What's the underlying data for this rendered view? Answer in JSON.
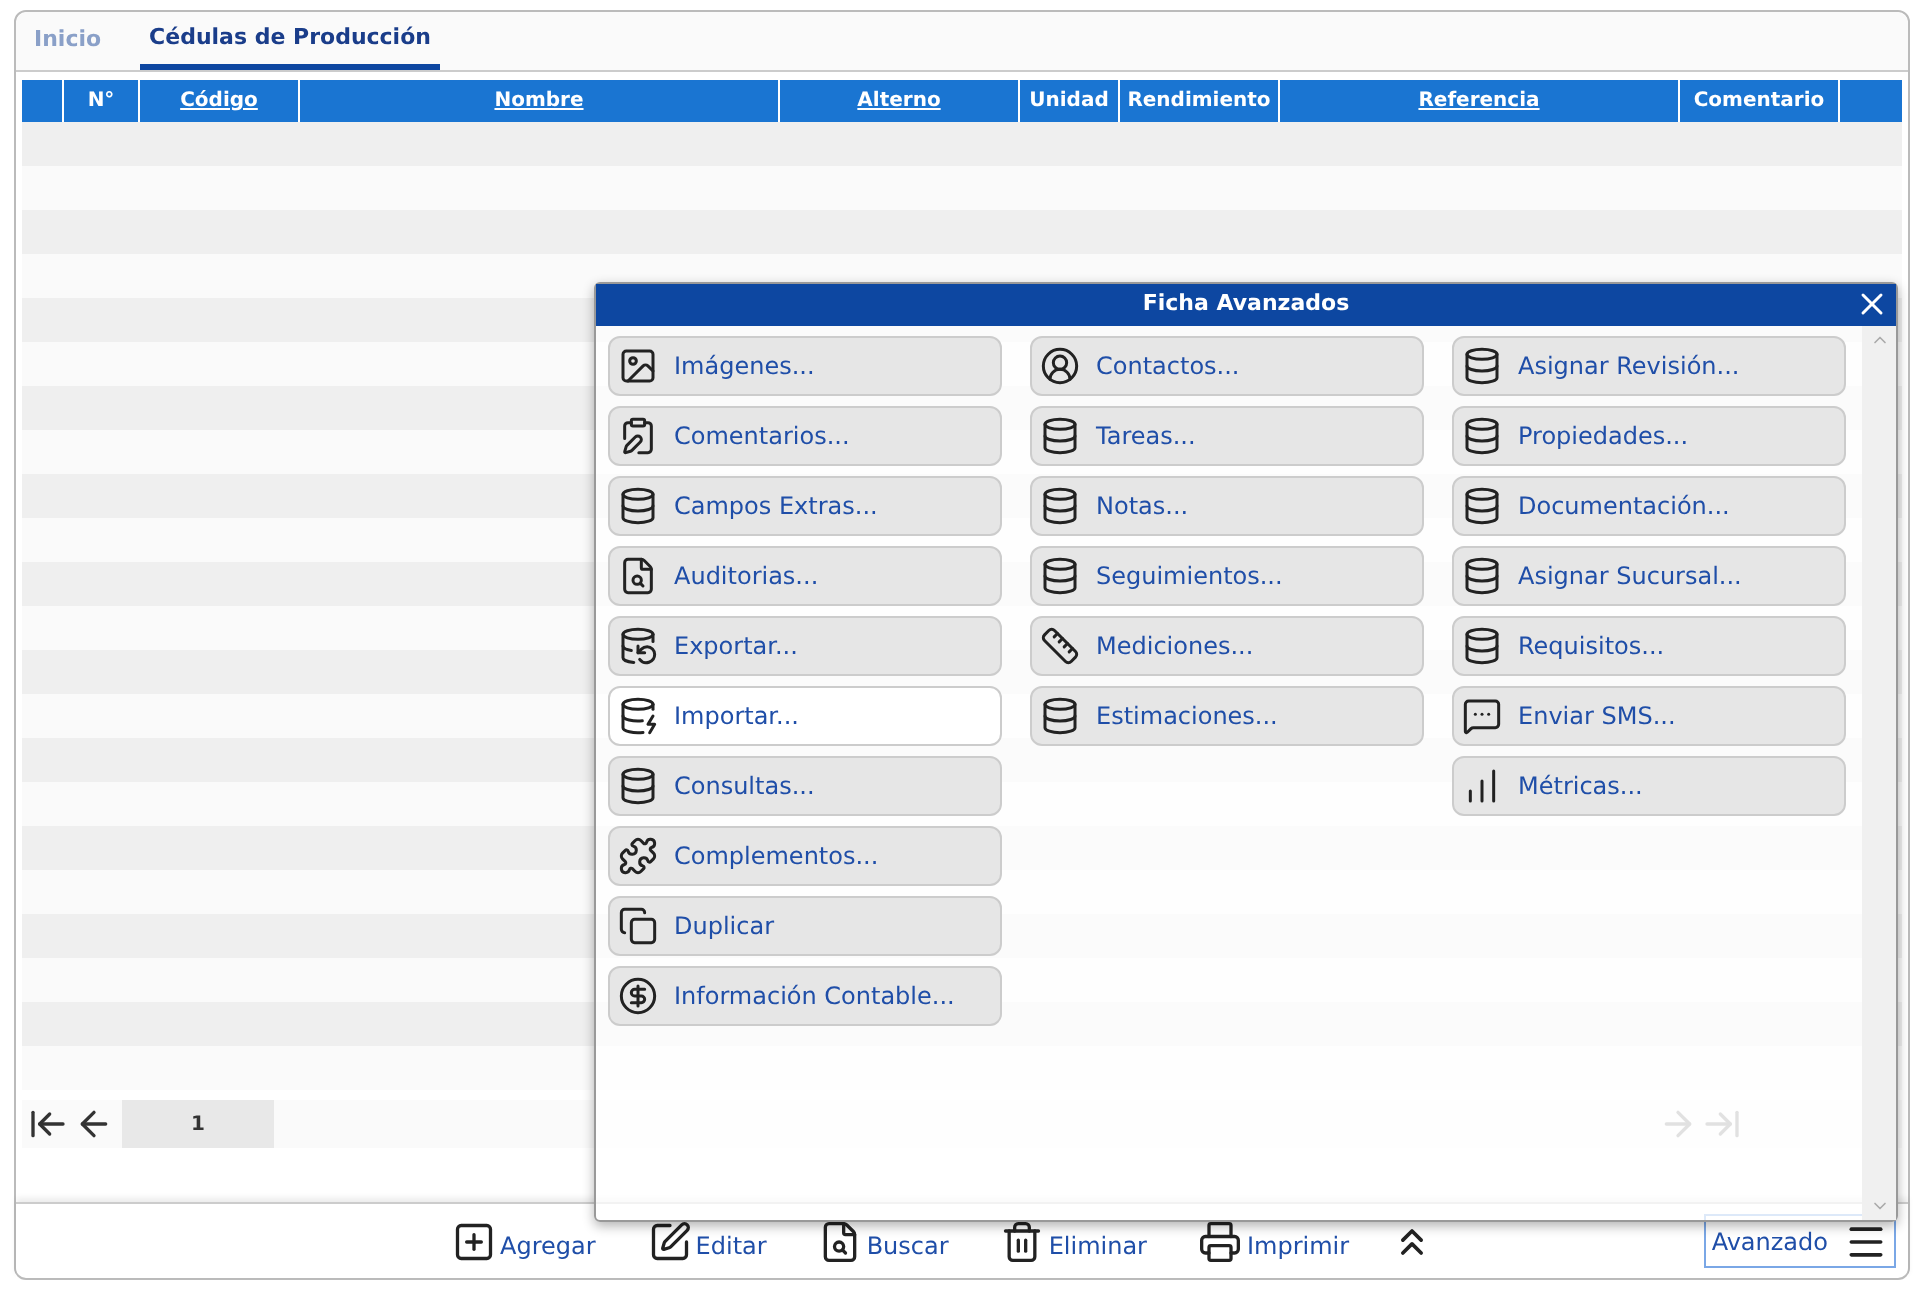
{
  "tabs": [
    {
      "label": "Inicio",
      "selected": false
    },
    {
      "label": "Cédulas de Producción",
      "selected": true
    }
  ],
  "table": {
    "columns": [
      {
        "label": "N°",
        "sortable": false
      },
      {
        "label": "Código",
        "sortable": true
      },
      {
        "label": "Nombre",
        "sortable": true
      },
      {
        "label": "Alterno",
        "sortable": true
      },
      {
        "label": "Unidad",
        "sortable": false
      },
      {
        "label": "Rendimiento",
        "sortable": false
      },
      {
        "label": "Referencia",
        "sortable": true
      },
      {
        "label": "Comentario",
        "sortable": false
      }
    ]
  },
  "pagination": {
    "page": "1"
  },
  "dialog": {
    "title": "Ficha Avanzados",
    "columns": [
      [
        {
          "label": "Imágenes...",
          "kind": "image",
          "selected": false
        },
        {
          "label": "Comentarios...",
          "kind": "clipboard",
          "selected": false
        },
        {
          "label": "Campos Extras...",
          "kind": "database",
          "selected": false
        },
        {
          "label": "Auditorias...",
          "kind": "audit",
          "selected": false
        },
        {
          "label": "Exportar...",
          "kind": "export",
          "selected": false
        },
        {
          "label": "Importar...",
          "kind": "import",
          "selected": true
        },
        {
          "label": "Consultas...",
          "kind": "database",
          "selected": false
        },
        {
          "label": "Complementos...",
          "kind": "puzzle",
          "selected": false
        },
        {
          "label": "Duplicar",
          "kind": "copy",
          "selected": false
        },
        {
          "label": "Información Contable...",
          "kind": "dollar",
          "selected": false
        }
      ],
      [
        {
          "label": "Contactos...",
          "kind": "contact",
          "selected": false
        },
        {
          "label": "Tareas...",
          "kind": "database",
          "selected": false
        },
        {
          "label": "Notas...",
          "kind": "database",
          "selected": false
        },
        {
          "label": "Seguimientos...",
          "kind": "database",
          "selected": false
        },
        {
          "label": "Mediciones...",
          "kind": "ruler",
          "selected": false
        },
        {
          "label": "Estimaciones...",
          "kind": "database",
          "selected": false
        }
      ],
      [
        {
          "label": "Asignar Revisión...",
          "kind": "database",
          "selected": false
        },
        {
          "label": "Propiedades...",
          "kind": "database",
          "selected": false
        },
        {
          "label": "Documentación...",
          "kind": "database",
          "selected": false
        },
        {
          "label": "Asignar Sucursal...",
          "kind": "database",
          "selected": false
        },
        {
          "label": "Requisitos...",
          "kind": "database",
          "selected": false
        },
        {
          "label": "Enviar SMS...",
          "kind": "sms",
          "selected": false
        },
        {
          "label": "Métricas...",
          "kind": "chart",
          "selected": false
        }
      ]
    ]
  },
  "toolbar": [
    {
      "label": "Agregar",
      "kind": "add"
    },
    {
      "label": "Editar",
      "kind": "edit"
    },
    {
      "label": "Buscar",
      "kind": "search"
    },
    {
      "label": "Eliminar",
      "kind": "delete"
    },
    {
      "label": "Imprimir",
      "kind": "print"
    }
  ],
  "advanced": {
    "label": "Avanzado"
  }
}
